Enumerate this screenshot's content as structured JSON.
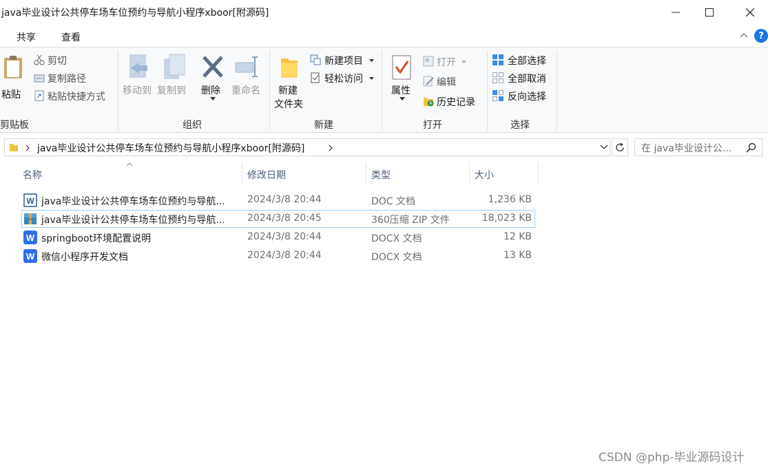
{
  "window": {
    "title": "java毕业设计公共停车场车位预约与导航小程序xboor[附源码]",
    "minimize_icon": "minimize-icon",
    "maximize_icon": "maximize-icon",
    "close_icon": "close-icon"
  },
  "ribbon_tabs": [
    "共享",
    "查看"
  ],
  "ribbon": {
    "clipboard": {
      "paste": "粘贴",
      "cut": "剪切",
      "copy_path": "复制路径",
      "paste_shortcut": "粘贴快捷方式",
      "label": "剪贴板"
    },
    "organize": {
      "move_to": "移动到",
      "copy_to": "复制到",
      "delete": "删除",
      "rename": "重命名",
      "label": "组织"
    },
    "new": {
      "new_folder_line1": "新建",
      "new_folder_line2": "文件夹",
      "new_item": "新建项目",
      "easy_access": "轻松访问",
      "label": "新建"
    },
    "open": {
      "properties": "属性",
      "open": "打开",
      "edit": "编辑",
      "history": "历史记录",
      "label": "打开"
    },
    "select": {
      "select_all": "全部选择",
      "select_none": "全部取消",
      "invert": "反向选择",
      "label": "选择"
    }
  },
  "address": {
    "path": "java毕业设计公共停车场车位预约与导航小程序xboor[附源码]",
    "search_placeholder": "在 java毕业设计公..."
  },
  "columns": {
    "name": "名称",
    "date": "修改日期",
    "type": "类型",
    "size": "大小"
  },
  "files": [
    {
      "name": "java毕业设计公共停车场车位预约与导航...",
      "date": "2024/3/8 20:44",
      "type": "DOC 文档",
      "size": "1,236 KB",
      "icon": "word-doc-icon"
    },
    {
      "name": "java毕业设计公共停车场车位预约与导航...",
      "date": "2024/3/8 20:45",
      "type": "360压缩 ZIP 文件",
      "size": "18,023 KB",
      "icon": "zip-archive-icon"
    },
    {
      "name": "springboot环境配置说明",
      "date": "2024/3/8 20:44",
      "type": "DOCX 文档",
      "size": "12 KB",
      "icon": "word-docx-icon"
    },
    {
      "name": "微信小程序开发文档",
      "date": "2024/3/8 20:44",
      "type": "DOCX 文档",
      "size": "13 KB",
      "icon": "word-docx-icon"
    }
  ],
  "watermark": "CSDN @php-毕业源码设计",
  "colors": {
    "accent": "#1a73e8",
    "selection_border": "#99d1ff",
    "column_header": "#4c607a",
    "word_blue": "#2b579a"
  }
}
